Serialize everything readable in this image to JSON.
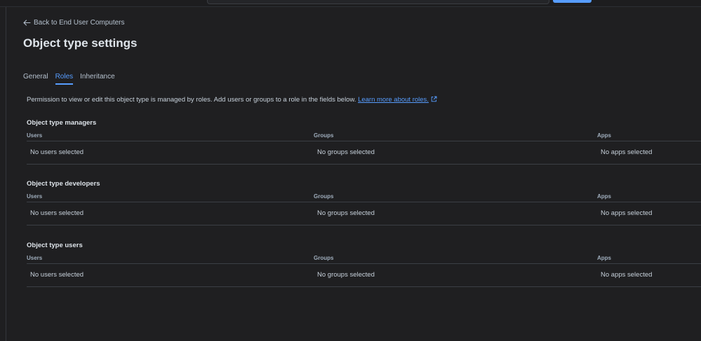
{
  "back_link": {
    "label": "Back to End User Computers"
  },
  "page_title": "Object type settings",
  "tabs": [
    {
      "label": "General",
      "active": false
    },
    {
      "label": "Roles",
      "active": true
    },
    {
      "label": "Inheritance",
      "active": false
    }
  ],
  "intro": {
    "text": "Permission to view or edit this object type is managed by roles. Add users or groups to a role in the fields below. ",
    "link_label": "Learn more about roles."
  },
  "columns": {
    "users": "Users",
    "groups": "Groups",
    "apps": "Apps"
  },
  "sections": [
    {
      "title": "Object type managers",
      "users": "No users selected",
      "groups": "No groups selected",
      "apps": "No apps selected"
    },
    {
      "title": "Object type developers",
      "users": "No users selected",
      "groups": "No groups selected",
      "apps": "No apps selected"
    },
    {
      "title": "Object type users",
      "users": "No users selected",
      "groups": "No groups selected",
      "apps": "No apps selected"
    }
  ],
  "icons": {
    "back": "arrow-left-icon",
    "external": "external-link-icon"
  },
  "colors": {
    "accent": "#579dff",
    "background": "#1f1f21"
  }
}
